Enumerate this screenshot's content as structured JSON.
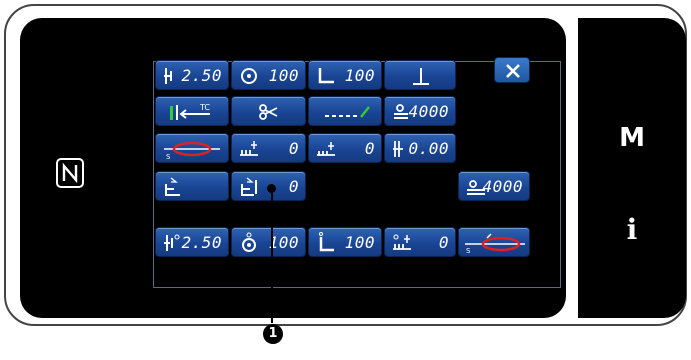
{
  "colors": {
    "button_blue": "#1a4594",
    "screen": "#000000",
    "red_mark": "#e02020",
    "green_mark": "#33cc33"
  },
  "nfc_logo": "nfc-logo-icon",
  "side_keys": {
    "m": "M",
    "i": "i"
  },
  "row1": {
    "v1": "2.50",
    "v2": "100",
    "v3": "100"
  },
  "row2": {
    "v4": "4000"
  },
  "row3": {
    "v1": "0",
    "v2": "0",
    "v3": "0.00"
  },
  "row4": {
    "v2": "0",
    "v3": "4000"
  },
  "row5": {
    "v1": "2.50",
    "v2": "100",
    "v3": "100",
    "v4": "0"
  },
  "callout": {
    "number": "1"
  }
}
